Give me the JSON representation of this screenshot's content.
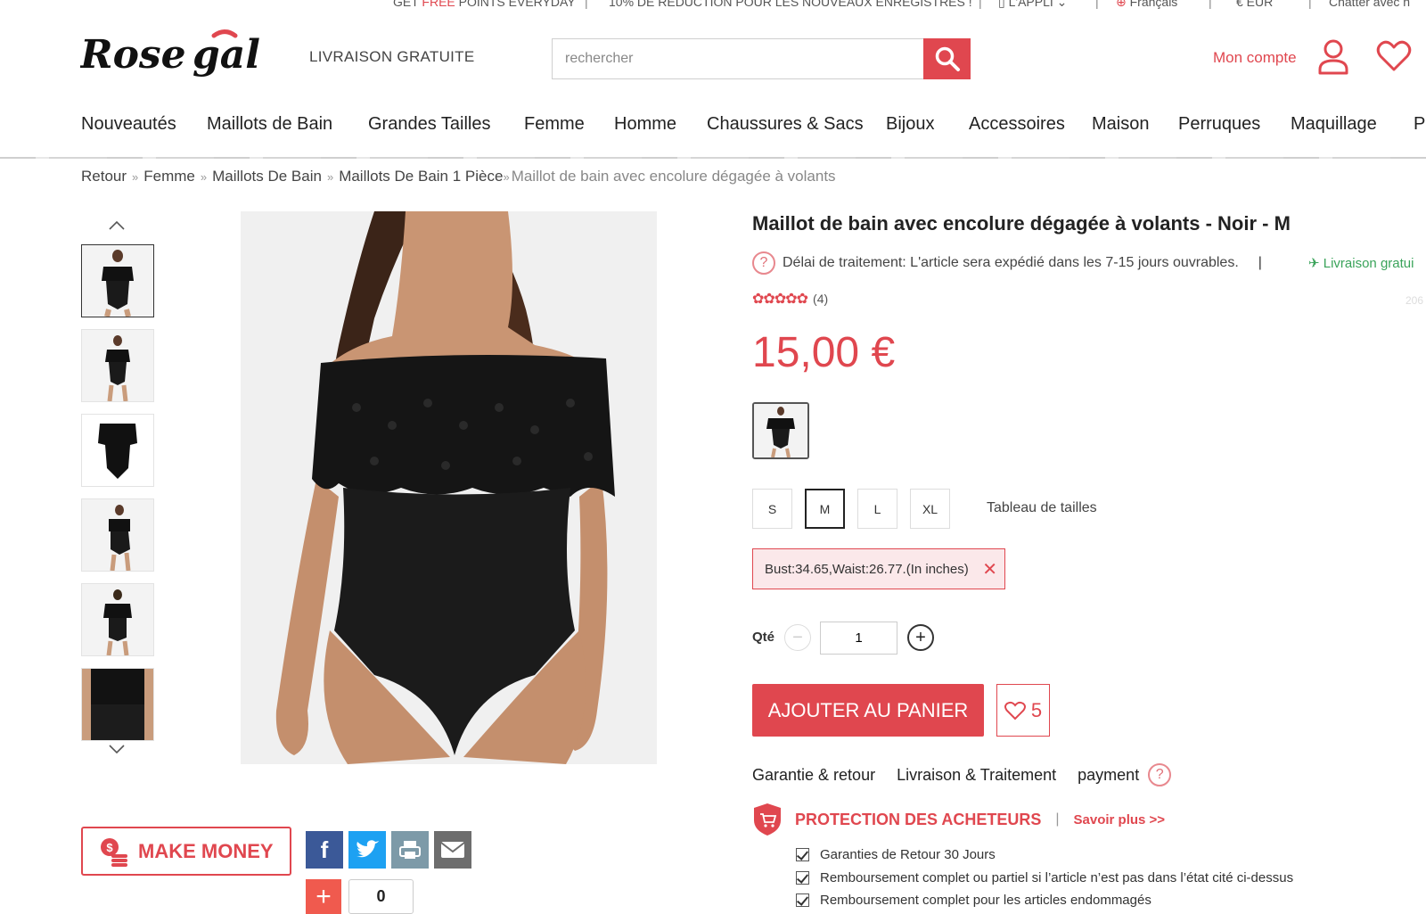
{
  "topbar": {
    "free_points_pre": "GET ",
    "free_points_free": "FREE",
    "free_points_post": " POINTS EVERYDAY",
    "discount": "10% DE RÉDUCTION POUR LES NOUVEAUX ENREGISTRÉS !",
    "app": "L'APPLI",
    "language": "Français",
    "currency": "€ EUR",
    "chat": "Chatter avec n"
  },
  "header": {
    "tagline": "LIVRAISON GRATUITE",
    "search_placeholder": "rechercher",
    "account_label": "Mon compte"
  },
  "nav": [
    "Nouveautés",
    "Maillots de Bain",
    "Grandes Tailles",
    "Femme",
    "Homme",
    "Chaussures & Sacs",
    "Bijoux",
    "Accessoires",
    "Maison",
    "Perruques",
    "Maquillage",
    "Pr"
  ],
  "breadcrumb": {
    "items": [
      "Retour",
      "Femme",
      "Maillots De Bain",
      "Maillots De Bain 1 Pièce"
    ],
    "current": "Maillot de bain avec encolure dégagée à volants"
  },
  "product": {
    "title": "Maillot de bain avec encolure dégagée à volants - Noir - M",
    "delay": "Délai de traitement: L'article sera expédié dans les 7-15 jours ouvrables.",
    "delay_sep": "|",
    "free_shipping": "Livraison gratui",
    "reviews": "(4)",
    "sku_fragment": "206",
    "price": "15,00 €",
    "rating_stars": 5,
    "sizes": [
      "S",
      "M",
      "L",
      "XL"
    ],
    "selected_size": "M",
    "size_chart": "Tableau de tailles",
    "measurements": "Bust:34.65,Waist:26.77.(In inches)",
    "qty_label": "Qté",
    "qty_value": "1",
    "add_to_cart": "AJOUTER AU PANIER",
    "wish_count": "5"
  },
  "tabs": [
    "Garantie & retour",
    "Livraison & Traitement",
    "payment"
  ],
  "protection": {
    "title": "PROTECTION DES ACHETEURS",
    "sep": "|",
    "more": "Savoir plus >>",
    "items": [
      "Garanties de Retour 30 Jours",
      "Remboursement complet ou partiel si l’article n’est pas dans l’état cité ci-dessus",
      "Remboursement complet pour les articles endommagés"
    ]
  },
  "social": {
    "make_money": "MAKE MONEY",
    "plus_count": "0"
  },
  "colors": {
    "accent": "#e0474f",
    "green": "#3aa35a"
  }
}
